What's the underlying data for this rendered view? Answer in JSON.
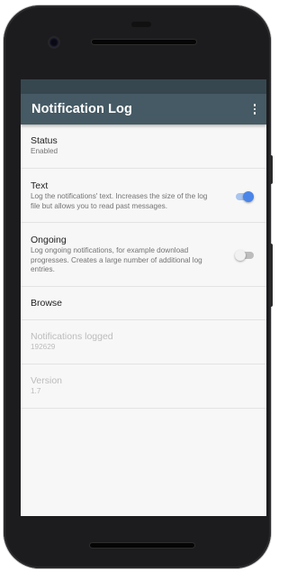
{
  "app": {
    "title": "Notification Log"
  },
  "prefs": {
    "status": {
      "title": "Status",
      "summary": "Enabled"
    },
    "text": {
      "title": "Text",
      "summary": "Log the notifications' text. Increases the size of the log file but allows you to read past messages.",
      "enabled": true
    },
    "ongoing": {
      "title": "Ongoing",
      "summary": "Log ongoing notifications, for example download progresses. Creates a large number of additional log entries.",
      "enabled": false
    },
    "browse": {
      "title": "Browse"
    },
    "logged": {
      "title": "Notifications logged",
      "summary": "192629"
    },
    "version": {
      "title": "Version",
      "summary": "1.7"
    }
  },
  "icons": {
    "overflow": "more-vert-icon"
  },
  "colors": {
    "app_bar": "#455a64",
    "status_bar": "#37474f",
    "switch_on": "#4a86e8",
    "background": "#f7f7f7"
  }
}
